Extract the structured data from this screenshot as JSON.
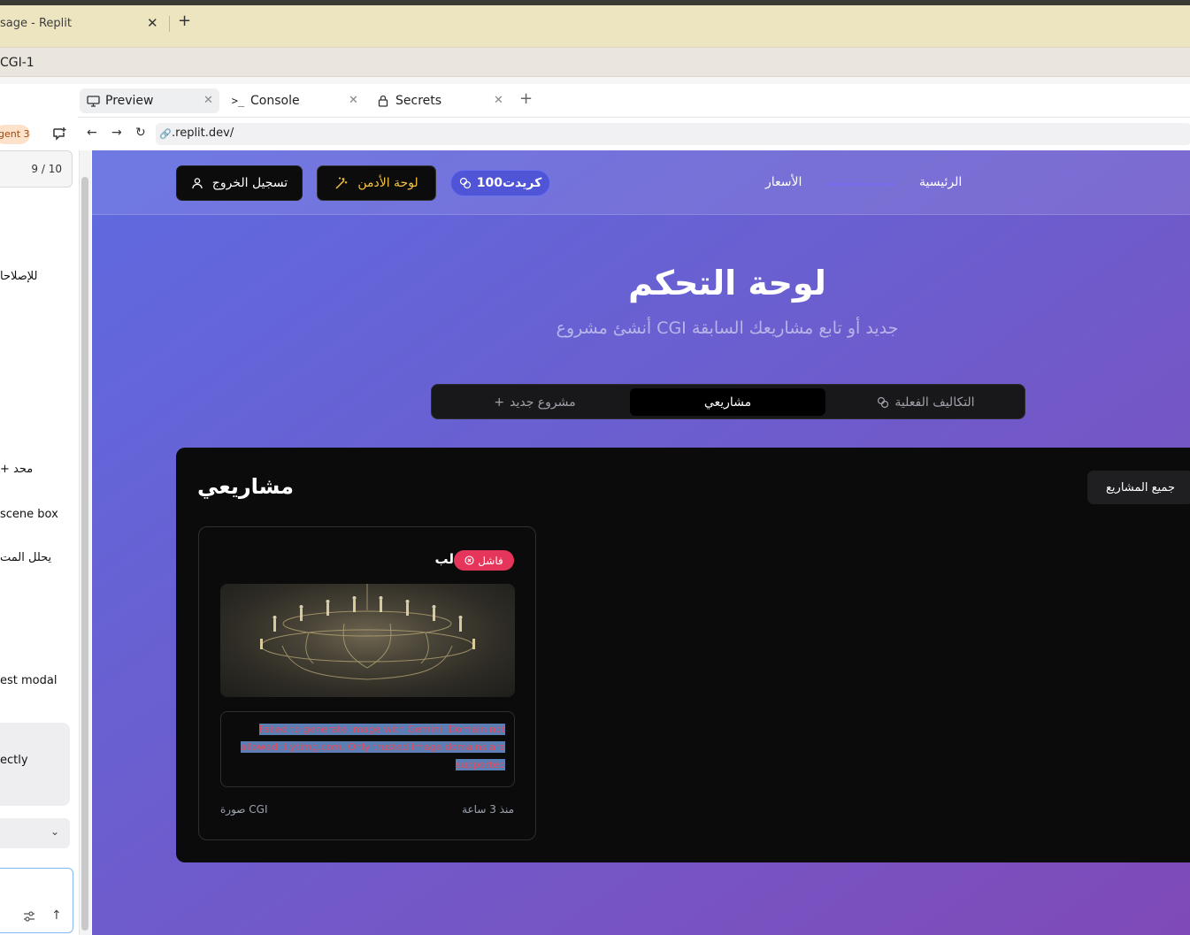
{
  "browser": {
    "tab_title": "sage - Replit",
    "address": "CGI-1"
  },
  "left_panel": {
    "agent_badge": "gent 3",
    "counter": "9 / 10",
    "lines": [
      "للإصلاحا",
      "+ محد",
      "scene box",
      "يحلل المت",
      "est modal",
      "ectly"
    ]
  },
  "workspace": {
    "tabs": [
      {
        "label": "Preview",
        "icon": "monitor-icon"
      },
      {
        "label": "Console",
        "icon": "terminal-icon"
      },
      {
        "label": "Secrets",
        "icon": "lock-icon"
      }
    ],
    "url": ".replit.dev/"
  },
  "app": {
    "header": {
      "logout_label": "تسجيل الخروج",
      "admin_label": "لوحة الأدمن",
      "credits_label": "100كريدت",
      "nav_home": "الرئيسية",
      "nav_pricing": "الأسعار"
    },
    "title": "لوحة التحكم",
    "subtitle": "أنشئ مشروع CGI جديد أو تابع مشاريعك السابقة",
    "tabs": {
      "new_project": "مشروع جديد",
      "my_projects": "مشاريعي",
      "actual_costs": "التكاليف الفعلية"
    },
    "projects": {
      "heading": "مشاريعي",
      "filter_label": "جميع المشاريع",
      "card": {
        "name": "لب",
        "status": "فاشل",
        "error": "Failed to generate image with Gemini: Domain not allowed: i.ytimg.com. Only trusted image domains are supported",
        "type": "صورة CGI",
        "time": "منذ 3 ساعة"
      }
    }
  },
  "colors": {
    "accent_gradient_start": "#5f6ae0",
    "accent_gradient_end": "#7f4ab8",
    "admin_gold": "#f5c542",
    "failed_red": "#e5355b"
  }
}
